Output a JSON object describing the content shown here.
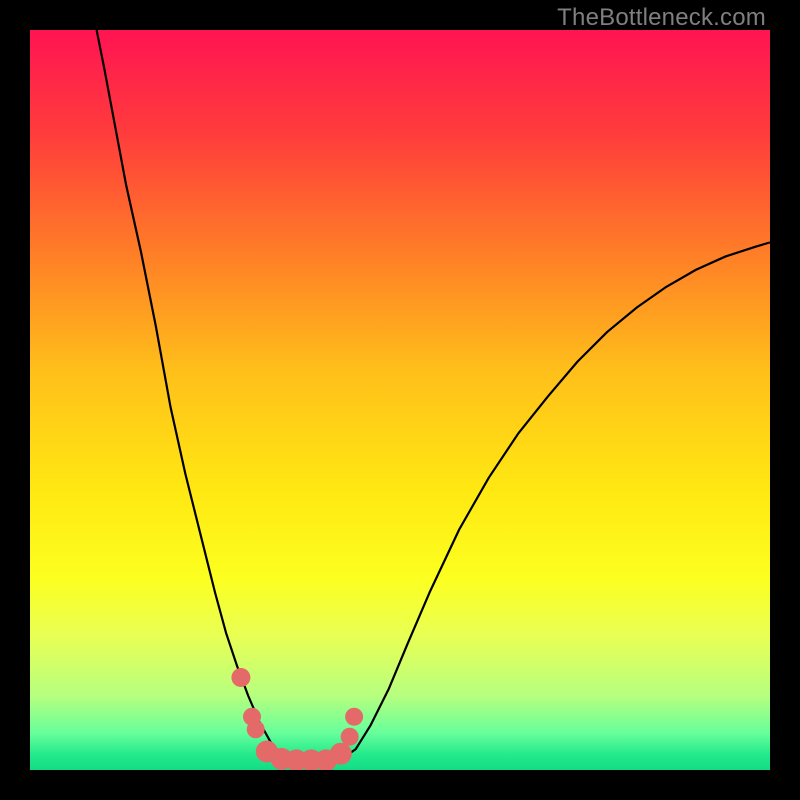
{
  "watermark": "TheBottleneck.com",
  "chart_data": {
    "type": "line",
    "title": "",
    "xlabel": "",
    "ylabel": "",
    "xlim": [
      0,
      1
    ],
    "ylim": [
      0,
      1
    ],
    "gradient_stops": [
      {
        "offset": 0.0,
        "color": "#ff1452"
      },
      {
        "offset": 0.14,
        "color": "#ff3c3c"
      },
      {
        "offset": 0.3,
        "color": "#ff7d27"
      },
      {
        "offset": 0.46,
        "color": "#ffbf1a"
      },
      {
        "offset": 0.62,
        "color": "#ffe812"
      },
      {
        "offset": 0.74,
        "color": "#fcff1f"
      },
      {
        "offset": 0.82,
        "color": "#e8ff55"
      },
      {
        "offset": 0.9,
        "color": "#b6ff7f"
      },
      {
        "offset": 0.95,
        "color": "#67ff9b"
      },
      {
        "offset": 0.98,
        "color": "#22e98b"
      },
      {
        "offset": 1.0,
        "color": "#14dc85"
      }
    ],
    "series": [
      {
        "name": "curve",
        "stroke": "#000000",
        "stroke_width": 2.2,
        "x": [
          0.09,
          0.1,
          0.115,
          0.13,
          0.15,
          0.17,
          0.19,
          0.21,
          0.23,
          0.25,
          0.265,
          0.28,
          0.295,
          0.31,
          0.325,
          0.34,
          0.36,
          0.38,
          0.4,
          0.42,
          0.44,
          0.46,
          0.485,
          0.51,
          0.54,
          0.58,
          0.62,
          0.66,
          0.7,
          0.74,
          0.78,
          0.82,
          0.86,
          0.9,
          0.94,
          0.98,
          1.0
        ],
        "y": [
          1.0,
          0.95,
          0.87,
          0.79,
          0.7,
          0.6,
          0.49,
          0.4,
          0.32,
          0.24,
          0.185,
          0.14,
          0.1,
          0.065,
          0.038,
          0.02,
          0.01,
          0.007,
          0.008,
          0.014,
          0.028,
          0.06,
          0.11,
          0.17,
          0.24,
          0.325,
          0.395,
          0.455,
          0.505,
          0.552,
          0.592,
          0.625,
          0.653,
          0.676,
          0.694,
          0.707,
          0.713
        ]
      }
    ],
    "markers": {
      "name": "points",
      "color": "#e46a6a",
      "x": [
        0.285,
        0.3,
        0.305,
        0.32,
        0.34,
        0.36,
        0.38,
        0.4,
        0.42,
        0.432,
        0.438
      ],
      "y": [
        0.125,
        0.072,
        0.055,
        0.025,
        0.015,
        0.013,
        0.013,
        0.013,
        0.022,
        0.045,
        0.072
      ],
      "r": [
        9.5,
        9.0,
        9.0,
        11.0,
        11.0,
        11.0,
        11.0,
        11.0,
        11.0,
        9.0,
        9.0
      ]
    }
  }
}
